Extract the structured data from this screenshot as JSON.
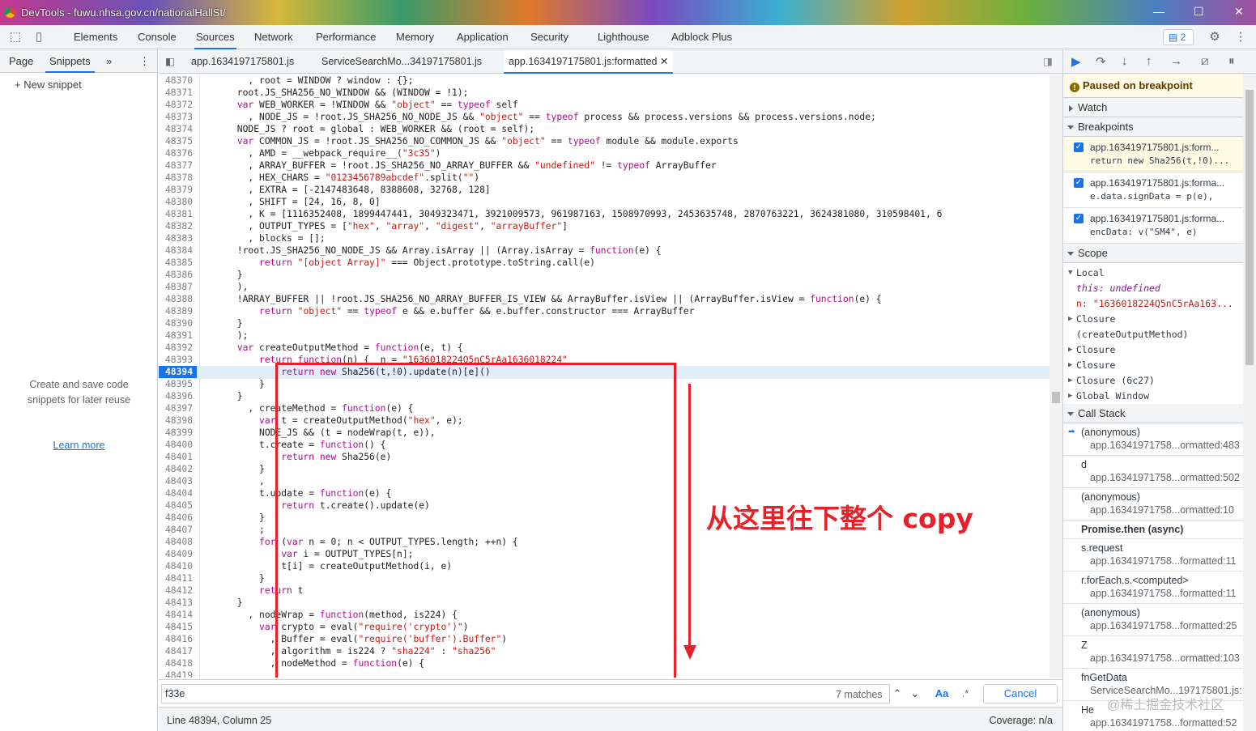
{
  "window": {
    "title": "DevTools - fuwu.nhsa.gov.cn/nationalHallSt/"
  },
  "main_tabs": [
    "Elements",
    "Console",
    "Sources",
    "Network",
    "Performance",
    "Memory",
    "Application",
    "Security",
    "Lighthouse",
    "Adblock Plus"
  ],
  "issues_count": "2",
  "left_panel": {
    "tabs": [
      "Page",
      "Snippets"
    ],
    "more": "»",
    "new_snippet": "+ New snippet",
    "empty_text": "Create and save code snippets for later reuse",
    "learn_more": "Learn more"
  },
  "editor": {
    "tabs": [
      "app.1634197175801.js",
      "ServiceSearchMo...34197175801.js",
      "app.1634197175801.js:formatted"
    ],
    "lines": [
      {
        "n": "48370",
        "t": "        , root = WINDOW ? window : {};"
      },
      {
        "n": "48371",
        "t": "      root.JS_SHA256_NO_WINDOW && (WINDOW = !1);"
      },
      {
        "n": "48372",
        "t": "      var WEB_WORKER = !WINDOW && \"object\" == typeof self"
      },
      {
        "n": "48373",
        "t": "        , NODE_JS = !root.JS_SHA256_NO_NODE_JS && \"object\" == typeof process && process.versions && process.versions.node;"
      },
      {
        "n": "48374",
        "t": "      NODE_JS ? root = global : WEB_WORKER && (root = self);"
      },
      {
        "n": "48375",
        "t": "      var COMMON_JS = !root.JS_SHA256_NO_COMMON_JS && \"object\" == typeof module && module.exports"
      },
      {
        "n": "48376",
        "t": "        , AMD = __webpack_require__(\"3c35\")"
      },
      {
        "n": "48377",
        "t": "        , ARRAY_BUFFER = !root.JS_SHA256_NO_ARRAY_BUFFER && \"undefined\" != typeof ArrayBuffer"
      },
      {
        "n": "48378",
        "t": "        , HEX_CHARS = \"0123456789abcdef\".split(\"\")"
      },
      {
        "n": "48379",
        "t": "        , EXTRA = [-2147483648, 8388608, 32768, 128]"
      },
      {
        "n": "48380",
        "t": "        , SHIFT = [24, 16, 8, 0]"
      },
      {
        "n": "48381",
        "t": "        , K = [1116352408, 1899447441, 3049323471, 3921009573, 961987163, 1508970993, 2453635748, 2870763221, 3624381080, 310598401, 6"
      },
      {
        "n": "48382",
        "t": "        , OUTPUT_TYPES = [\"hex\", \"array\", \"digest\", \"arrayBuffer\"]"
      },
      {
        "n": "48383",
        "t": "        , blocks = [];"
      },
      {
        "n": "48384",
        "t": "      !root.JS_SHA256_NO_NODE_JS && Array.isArray || (Array.isArray = function(e) {"
      },
      {
        "n": "48385",
        "t": "          return \"[object Array]\" === Object.prototype.toString.call(e)"
      },
      {
        "n": "48386",
        "t": "      }"
      },
      {
        "n": "48387",
        "t": "      ),"
      },
      {
        "n": "48388",
        "t": "      !ARRAY_BUFFER || !root.JS_SHA256_NO_ARRAY_BUFFER_IS_VIEW && ArrayBuffer.isView || (ArrayBuffer.isView = function(e) {"
      },
      {
        "n": "48389",
        "t": "          return \"object\" == typeof e && e.buffer && e.buffer.constructor === ArrayBuffer"
      },
      {
        "n": "48390",
        "t": "      }"
      },
      {
        "n": "48391",
        "t": "      );"
      },
      {
        "n": "48392",
        "t": "      var createOutputMethod = function(e, t) {"
      },
      {
        "n": "48393",
        "t": "          return function(n) {  n = \"1636018224Q5nC5rAa1636018224\""
      },
      {
        "n": "48394",
        "t": "              return new Sha256(t,!0).update(n)[e]()"
      },
      {
        "n": "48395",
        "t": "          }"
      },
      {
        "n": "48396",
        "t": "      }"
      },
      {
        "n": "48397",
        "t": "        , createMethod = function(e) {"
      },
      {
        "n": "48398",
        "t": "          var t = createOutputMethod(\"hex\", e);"
      },
      {
        "n": "48399",
        "t": "          NODE_JS && (t = nodeWrap(t, e)),"
      },
      {
        "n": "48400",
        "t": "          t.create = function() {"
      },
      {
        "n": "48401",
        "t": "              return new Sha256(e)"
      },
      {
        "n": "48402",
        "t": "          }"
      },
      {
        "n": "48403",
        "t": "          ,"
      },
      {
        "n": "48404",
        "t": "          t.update = function(e) {"
      },
      {
        "n": "48405",
        "t": "              return t.create().update(e)"
      },
      {
        "n": "48406",
        "t": "          }"
      },
      {
        "n": "48407",
        "t": "          ;"
      },
      {
        "n": "48408",
        "t": "          for (var n = 0; n < OUTPUT_TYPES.length; ++n) {"
      },
      {
        "n": "48409",
        "t": "              var i = OUTPUT_TYPES[n];"
      },
      {
        "n": "48410",
        "t": "              t[i] = createOutputMethod(i, e)"
      },
      {
        "n": "48411",
        "t": "          }"
      },
      {
        "n": "48412",
        "t": "          return t"
      },
      {
        "n": "48413",
        "t": "      }"
      },
      {
        "n": "48414",
        "t": "        , nodeWrap = function(method, is224) {"
      },
      {
        "n": "48415",
        "t": "          var crypto = eval(\"require('crypto')\")"
      },
      {
        "n": "48416",
        "t": "            , Buffer = eval(\"require('buffer').Buffer\")"
      },
      {
        "n": "48417",
        "t": "            , algorithm = is224 ? \"sha224\" : \"sha256\""
      },
      {
        "n": "48418",
        "t": "            , nodeMethod = function(e) {"
      },
      {
        "n": "48419",
        "t": ""
      }
    ],
    "current_line": "48394",
    "annotation": "从这里往下整个 copy",
    "search_value": "f33e",
    "matches": "7 matches",
    "match_case": "Aa",
    "regex": ".*",
    "cancel": "Cancel",
    "status_left": "Line 48394, Column 25",
    "status_right": "Coverage: n/a"
  },
  "debugger": {
    "paused": "Paused on breakpoint",
    "watch": "Watch",
    "breakpoints_title": "Breakpoints",
    "breakpoints": [
      {
        "file": "app.1634197175801.js:form...",
        "code": "return new Sha256(t,!0)..."
      },
      {
        "file": "app.1634197175801.js:forma...",
        "code": "e.data.signData = p(e),"
      },
      {
        "file": "app.1634197175801.js:forma...",
        "code": "encData: v(\"SM4\", e)"
      }
    ],
    "scope_title": "Scope",
    "scope": [
      {
        "t": "Local",
        "tri": "▼"
      },
      {
        "t": "  this: undefined",
        "tri": ""
      },
      {
        "t": "  n: \"1636018224Q5nC5rAa163...",
        "tri": ""
      },
      {
        "t": "Closure",
        "tri": "▶"
      },
      {
        "t": "(createOutputMethod)",
        "tri": ""
      },
      {
        "t": "Closure",
        "tri": "▶"
      },
      {
        "t": "Closure",
        "tri": "▶"
      },
      {
        "t": "Closure (6c27)",
        "tri": "▶"
      },
      {
        "t": "Global                Window",
        "tri": "▶"
      }
    ],
    "callstack_title": "Call Stack",
    "callstack": [
      {
        "fn": "(anonymous)",
        "loc": "app.16341971758...ormatted:483"
      },
      {
        "fn": "d",
        "loc": "app.16341971758...ormatted:502"
      },
      {
        "fn": "(anonymous)",
        "loc": "app.16341971758...ormatted:10"
      },
      {
        "fn": "s.request",
        "loc": "app.16341971758...formatted:11"
      },
      {
        "fn": "r.forEach.s.<computed>",
        "loc": "app.16341971758...formatted:11"
      },
      {
        "fn": "(anonymous)",
        "loc": "app.16341971758...formatted:25"
      },
      {
        "fn": "Z",
        "loc": "app.16341971758...ormatted:103"
      },
      {
        "fn": "fnGetData",
        "loc": "ServiceSearchMo...197175801.js:"
      },
      {
        "fn": "He",
        "loc": "app.16341971758...formatted:52"
      }
    ],
    "async_label": "Promise.then (async)",
    "watermark": "@稀土掘金技术社区"
  }
}
